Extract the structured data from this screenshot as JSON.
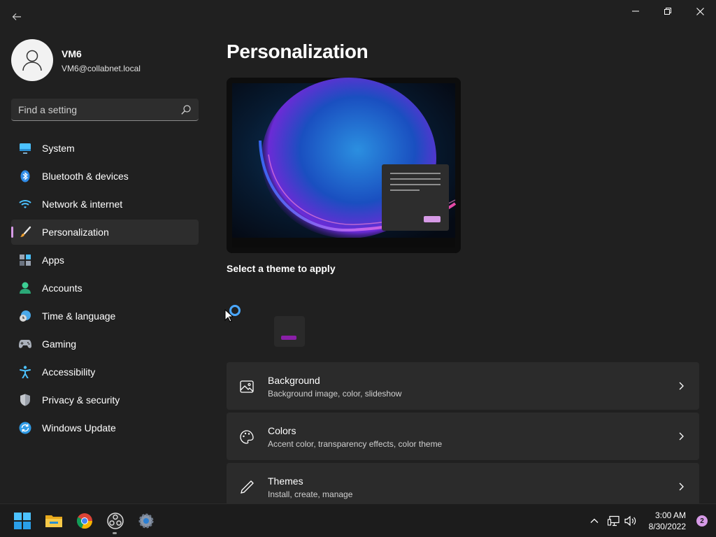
{
  "window": {
    "back_label": "Back",
    "minimize_label": "Minimize",
    "restore_label": "Restore",
    "close_label": "Close"
  },
  "profile": {
    "name": "VM6",
    "email": "VM6@collabnet.local"
  },
  "search": {
    "placeholder": "Find a setting"
  },
  "sidebar": {
    "items": [
      {
        "label": "System",
        "icon": "system-icon",
        "active": false
      },
      {
        "label": "Bluetooth & devices",
        "icon": "bluetooth-icon",
        "active": false
      },
      {
        "label": "Network & internet",
        "icon": "wifi-icon",
        "active": false
      },
      {
        "label": "Personalization",
        "icon": "brush-icon",
        "active": true
      },
      {
        "label": "Apps",
        "icon": "apps-icon",
        "active": false
      },
      {
        "label": "Accounts",
        "icon": "accounts-icon",
        "active": false
      },
      {
        "label": "Time & language",
        "icon": "clock-globe-icon",
        "active": false
      },
      {
        "label": "Gaming",
        "icon": "gamepad-icon",
        "active": false
      },
      {
        "label": "Accessibility",
        "icon": "accessibility-icon",
        "active": false
      },
      {
        "label": "Privacy & security",
        "icon": "shield-icon",
        "active": false
      },
      {
        "label": "Windows Update",
        "icon": "update-icon",
        "active": false
      }
    ]
  },
  "main": {
    "title": "Personalization",
    "theme_section_label": "Select a theme to apply",
    "cards": [
      {
        "title": "Background",
        "subtitle": "Background image, color, slideshow",
        "icon": "image-icon"
      },
      {
        "title": "Colors",
        "subtitle": "Accent color, transparency effects, color theme",
        "icon": "palette-icon"
      },
      {
        "title": "Themes",
        "subtitle": "Install, create, manage",
        "icon": "pen-icon"
      }
    ]
  },
  "taskbar": {
    "time": "3:00 AM",
    "date": "8/30/2022",
    "notification_count": "2"
  },
  "colors": {
    "accent": "#d69ae6",
    "background": "#202020",
    "card": "#2b2b2b"
  }
}
